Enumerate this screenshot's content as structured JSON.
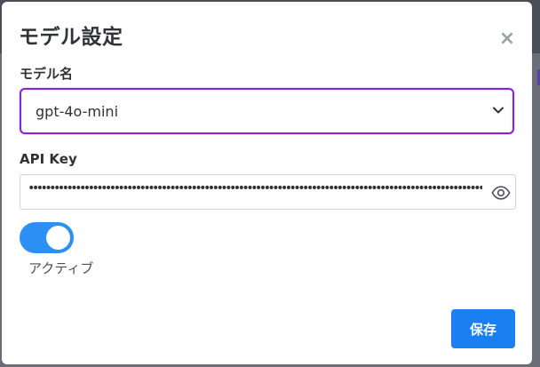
{
  "dialog": {
    "title": "モデル設定",
    "close_icon": "×"
  },
  "model": {
    "label": "モデル名",
    "selected": "gpt-4o-mini"
  },
  "api_key": {
    "label": "API Key",
    "masked_value": "•••••••••••••••••••••••••••••••••••••••••••••••••••••••••••••••••••••••••••••••••••••••••••••••••••••••••••••••••••••"
  },
  "active": {
    "label": "アクティブ",
    "on": true
  },
  "actions": {
    "save_label": "保存"
  },
  "colors": {
    "select_border": "#8a22d8",
    "toggle_on": "#2b8ff3",
    "primary_button": "#1a7ff0"
  },
  "icons": {
    "close": "close-icon",
    "chevron": "chevron-down-icon",
    "eye": "eye-icon"
  }
}
